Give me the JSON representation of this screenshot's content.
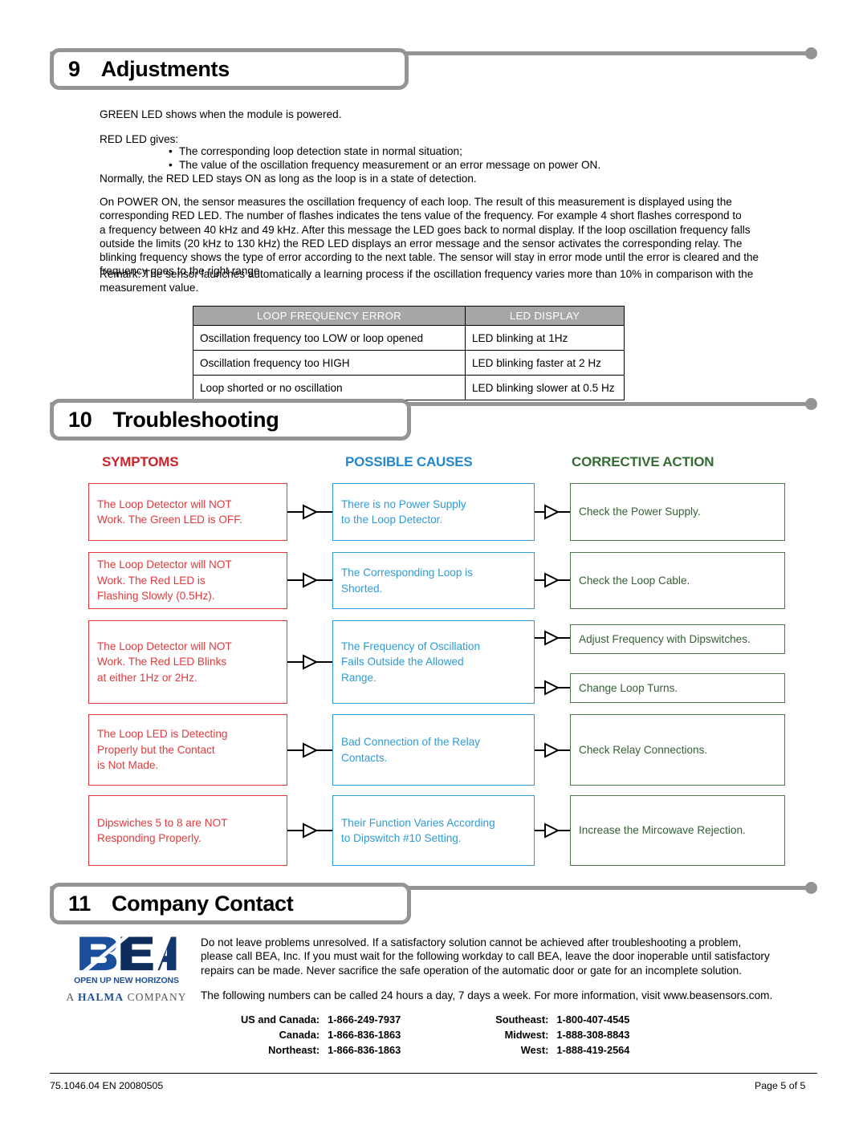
{
  "document": {
    "footer_left": "75.1046.04  EN  20080505",
    "footer_right": "Page 5 of 5"
  },
  "sections": {
    "adjustments": {
      "number": "9",
      "title": "Adjustments",
      "intro_line1": "GREEN LED shows when the module is powered.",
      "intro_line2": "RED LED gives:",
      "bullets": [
        "The corresponding loop detection state in normal situation;",
        "The value of the oscillation frequency measurement or an error message on power ON."
      ],
      "after_bullets": "Normally, the RED LED stays ON as long as the loop is in a state of detection.",
      "paragraph_lines": [
        "On POWER ON, the sensor measures the oscillation frequency of each loop.  The result of this measurement is displayed using the",
        "corresponding RED LED. The number of flashes indicates the tens value of the frequency.  For example 4 short flashes correspond to",
        "a frequency between 40 kHz and 49 kHz. After this message the LED goes back to normal display.  If the loop oscillation frequency falls",
        "outside the limits (20 kHz to 130 kHz) the RED LED displays an error message and the sensor activates the corresponding relay.  The",
        "blinking frequency shows the type of error according to the next table.  The sensor will stay in error mode until the error is cleared and the",
        "frequency goes to the right range."
      ],
      "remark_lines": [
        "Remark:  The sensor launches automatically a learning process if the oscillation frequency varies more than 10% in comparison with the",
        "measurement value."
      ],
      "led_table": {
        "headers": [
          "LOOP FREQUENCY ERROR",
          "LED DISPLAY"
        ],
        "rows": [
          [
            "Oscillation frequency too LOW or loop opened",
            "LED blinking at 1Hz"
          ],
          [
            "Oscillation frequency too HIGH",
            "LED blinking faster at 2 Hz"
          ],
          [
            "Loop shorted or no oscillation",
            "LED blinking slower at 0.5 Hz"
          ]
        ]
      }
    },
    "troubleshooting": {
      "number": "10",
      "title": "Troubleshooting",
      "column_headers": {
        "symptoms": "SYMPTOMS",
        "causes": "POSSIBLE CAUSES",
        "actions": "CORRECTIVE ACTION"
      },
      "rows": [
        {
          "symptom": [
            "The Loop Detector will NOT",
            "Work.  The Green LED is OFF."
          ],
          "cause": [
            "There is no Power Supply",
            "to the Loop Detector."
          ],
          "actions": [
            [
              "Check the Power Supply."
            ]
          ]
        },
        {
          "symptom": [
            "The Loop Detector will NOT",
            "Work.  The Red LED is",
            "Flashing Slowly (0.5Hz)."
          ],
          "cause": [
            "The Corresponding Loop is",
            "Shorted."
          ],
          "actions": [
            [
              "Check the Loop Cable."
            ]
          ]
        },
        {
          "symptom": [
            "The Loop Detector will NOT",
            "Work.  The Red LED Blinks",
            "at either 1Hz or 2Hz."
          ],
          "cause": [
            "The Frequency of Oscillation",
            "Fails Outside the Allowed",
            "Range."
          ],
          "actions": [
            [
              "Adjust Frequency with Dipswitches."
            ],
            [
              "Change Loop Turns."
            ]
          ]
        },
        {
          "symptom": [
            "The Loop LED is Detecting",
            "Properly but the Contact",
            "is Not Made."
          ],
          "cause": [
            "Bad Connection of the Relay",
            "Contacts."
          ],
          "actions": [
            [
              "Check Relay Connections."
            ]
          ]
        },
        {
          "symptom": [
            "Dipswiches 5 to 8 are NOT",
            "Responding Properly."
          ],
          "cause": [
            "Their Function Varies According",
            "to Dipswitch #10 Setting."
          ],
          "actions": [
            [
              "Increase the Mircowave Rejection."
            ]
          ]
        }
      ]
    },
    "company_contact": {
      "number": "11",
      "title": "Company Contact",
      "logo": {
        "wordmark": "BEA",
        "tagline": "OPEN UP NEW HORIZONS",
        "halma_a": "A",
        "halma_bold": "HALMA",
        "halma_rest": "COMPANY"
      },
      "paragraph_lines": [
        "Do not leave problems unresolved.  If a satisfactory solution cannot be achieved after troubleshooting a problem,",
        "please call BEA, Inc.  If you must wait for the following workday to call BEA, leave the door inoperable until satisfactory",
        "repairs can be made.  Never sacrifice the safe operation of the automatic door or gate for an incomplete solution."
      ],
      "hours_line": "The following numbers can be called 24 hours a day, 7 days a week.  For more information, visit www.beasensors.com.",
      "phone_rows": [
        {
          "left_label": "US and Canada:",
          "left_value": "1-866-249-7937",
          "right_label": "Southeast:",
          "right_value": "1-800-407-4545"
        },
        {
          "left_label": "Canada:",
          "left_value": "1-866-836-1863",
          "right_label": "Midwest:",
          "right_value": "1-888-308-8843"
        },
        {
          "left_label": "Northeast:",
          "left_value": "1-866-836-1863",
          "right_label": "West:",
          "right_value": "1-888-419-2564"
        }
      ]
    }
  },
  "colors": {
    "symptom": "#e03a3e",
    "cause": "#2e9bd6",
    "action": "#4a7a4a",
    "header_gray": "#949494",
    "table_header": "#a6a6a6"
  }
}
